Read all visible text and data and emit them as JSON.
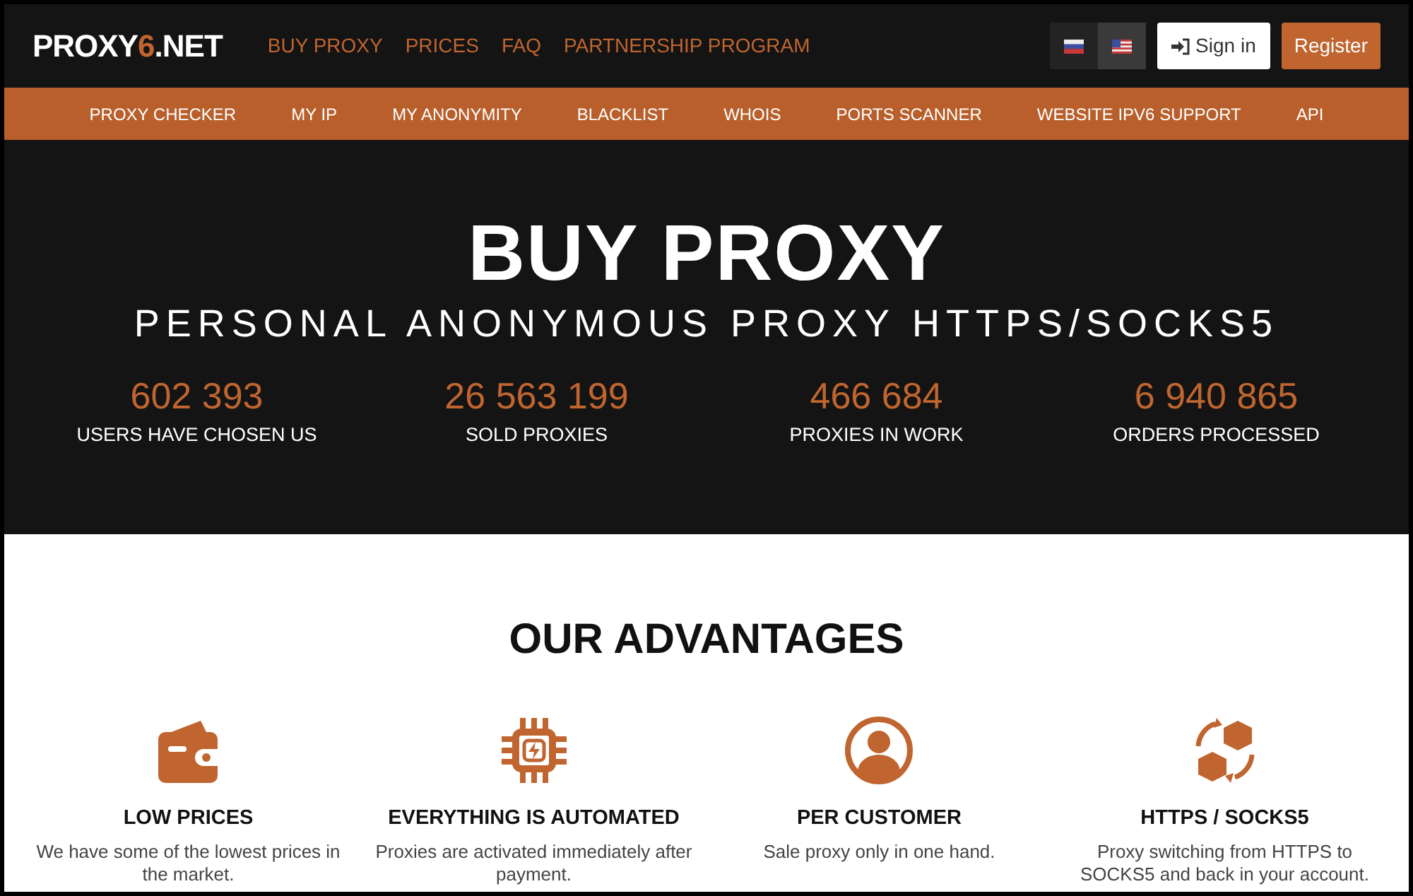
{
  "logo": {
    "prefix": "PROXY",
    "accent": "6",
    "suffix": ".NET"
  },
  "main_nav": [
    "BUY PROXY",
    "PRICES",
    "FAQ",
    "PARTNERSHIP PROGRAM"
  ],
  "languages": [
    {
      "kind": "ru",
      "selected": false
    },
    {
      "kind": "us",
      "selected": true
    }
  ],
  "sign_in": "Sign in",
  "register": "Register",
  "tools_nav": [
    "PROXY CHECKER",
    "MY IP",
    "MY ANONYMITY",
    "BLACKLIST",
    "WHOIS",
    "PORTS SCANNER",
    "WEBSITE IPV6 SUPPORT",
    "API"
  ],
  "hero": {
    "title": "BUY PROXY",
    "subtitle": "PERSONAL ANONYMOUS PROXY HTTPS/SOCKS5",
    "stats": [
      {
        "value": "602 393",
        "label": "USERS HAVE CHOSEN US"
      },
      {
        "value": "26 563 199",
        "label": "SOLD PROXIES"
      },
      {
        "value": "466 684",
        "label": "PROXIES IN WORK"
      },
      {
        "value": "6 940 865",
        "label": "ORDERS PROCESSED"
      }
    ]
  },
  "advantages": {
    "title": "OUR ADVANTAGES",
    "items": [
      {
        "kind": "wallet",
        "title": "LOW PRICES",
        "text": "We have some of the lowest prices in the market."
      },
      {
        "kind": "chip",
        "title": "EVERYTHING IS AUTOMATED",
        "text": "Proxies are activated immediately after payment."
      },
      {
        "kind": "user",
        "title": "PER CUSTOMER",
        "text": "Sale proxy only in one hand."
      },
      {
        "kind": "cubes",
        "title": "HTTPS / SOCKS5",
        "text": "Proxy switching from HTTPS to SOCKS5 and back in your account."
      }
    ]
  }
}
